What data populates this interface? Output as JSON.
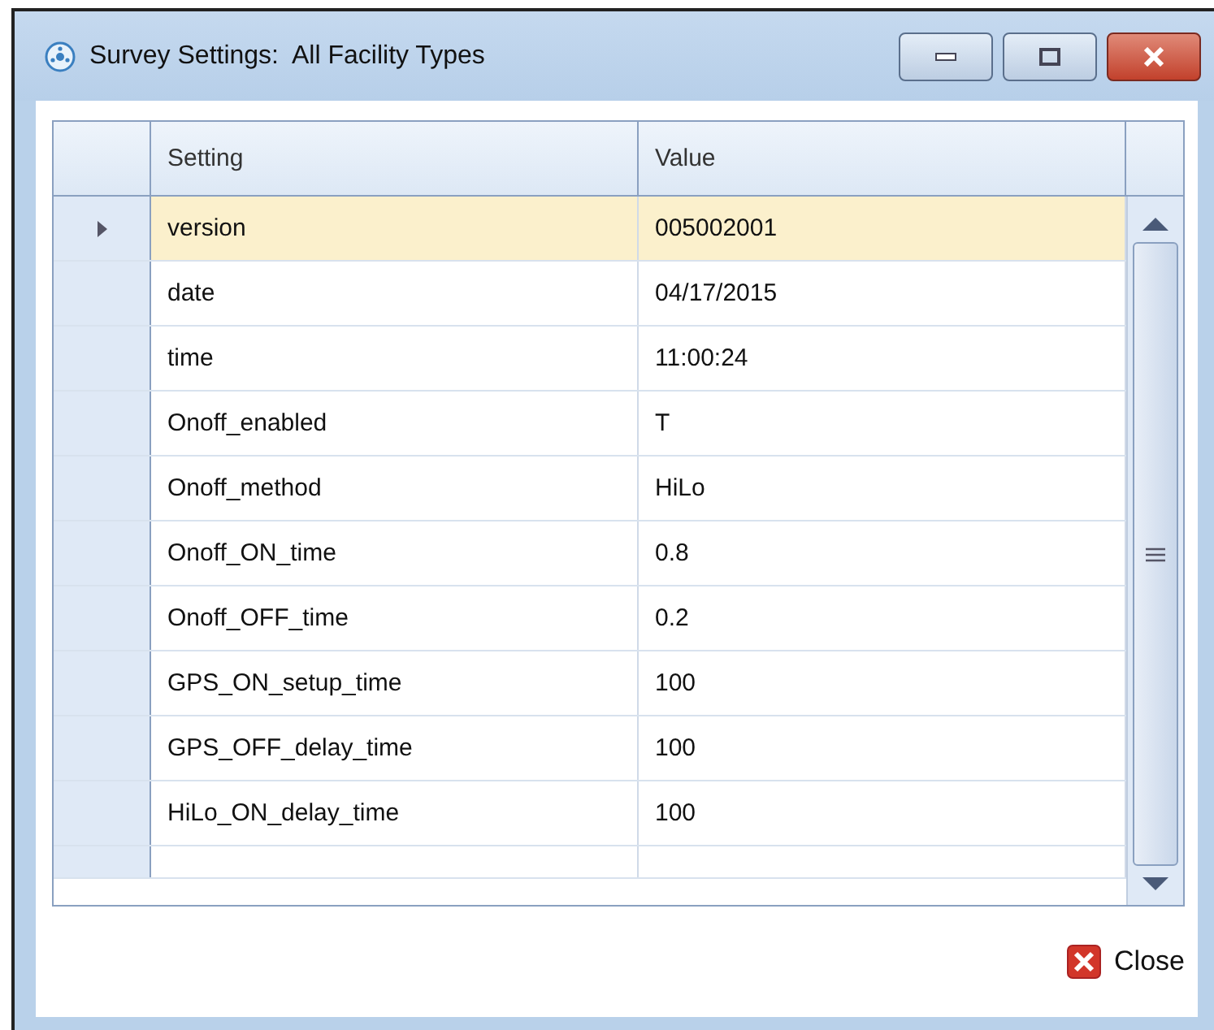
{
  "window": {
    "title": "Survey Settings:  All Facility Types"
  },
  "table": {
    "columns": [
      "Setting",
      "Value"
    ],
    "rows": [
      {
        "setting": "version",
        "value": "005002001",
        "selected": true
      },
      {
        "setting": "date",
        "value": "04/17/2015",
        "selected": false
      },
      {
        "setting": "time",
        "value": "11:00:24",
        "selected": false
      },
      {
        "setting": "Onoff_enabled",
        "value": "T",
        "selected": false
      },
      {
        "setting": "Onoff_method",
        "value": "HiLo",
        "selected": false
      },
      {
        "setting": "Onoff_ON_time",
        "value": "0.8",
        "selected": false
      },
      {
        "setting": "Onoff_OFF_time",
        "value": "0.2",
        "selected": false
      },
      {
        "setting": "GPS_ON_setup_time",
        "value": "100",
        "selected": false
      },
      {
        "setting": "GPS_OFF_delay_time",
        "value": "100",
        "selected": false
      },
      {
        "setting": "HiLo_ON_delay_time",
        "value": "100",
        "selected": false
      }
    ]
  },
  "buttons": {
    "close": "Close"
  }
}
